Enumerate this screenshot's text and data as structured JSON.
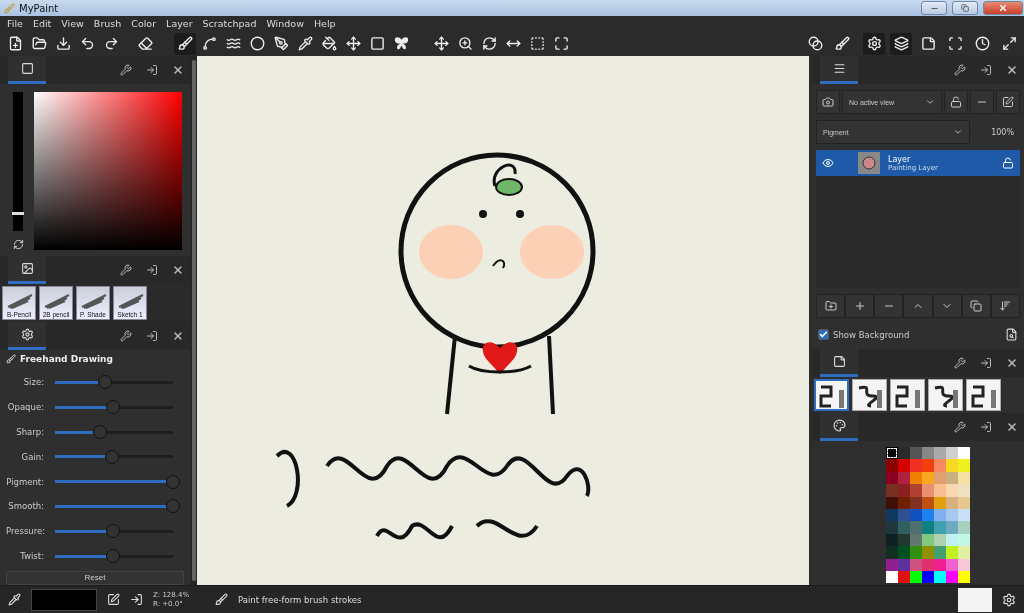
{
  "window": {
    "title": "MyPaint"
  },
  "menu": [
    "File",
    "Edit",
    "View",
    "Brush",
    "Color",
    "Layer",
    "Scratchpad",
    "Window",
    "Help"
  ],
  "toolbar": {
    "tools": [
      {
        "selected": false
      },
      {
        "selected": false
      },
      {
        "selected": false
      },
      {
        "selected": false
      },
      {
        "selected": false
      },
      {
        "selected": false
      },
      {
        "selected": true
      },
      {
        "selected": false
      },
      {
        "selected": false
      },
      {
        "selected": false
      },
      {
        "selected": false
      },
      {
        "selected": false
      },
      {
        "selected": false
      },
      {
        "selected": false
      },
      {
        "selected": false
      },
      {
        "selected": false
      },
      {
        "selected": false
      },
      {
        "selected": false
      },
      {
        "selected": false
      },
      {
        "selected": false
      },
      {
        "selected": false
      },
      {
        "selected": false
      }
    ],
    "panels": [
      {
        "selected": false
      },
      {
        "selected": false
      },
      {
        "selected": true
      },
      {
        "selected": true
      },
      {
        "selected": false
      },
      {
        "selected": false
      },
      {
        "selected": false
      },
      {
        "selected": false
      }
    ]
  },
  "brush_list": {
    "brushes": [
      {
        "label": "B-Pencil",
        "selected": false
      },
      {
        "label": "2B pencil",
        "selected": false
      },
      {
        "label": "P. Shade",
        "selected": false
      },
      {
        "label": "Sketch 1",
        "selected": false
      }
    ]
  },
  "brush_settings": {
    "title": "Freehand Drawing",
    "sliders": [
      {
        "label": "Size:",
        "level": 0.42
      },
      {
        "label": "Opaque:",
        "level": 0.49
      },
      {
        "label": "Sharp:",
        "level": 0.38
      },
      {
        "label": "Gain:",
        "level": 0.48
      },
      {
        "label": "Pigment:",
        "level": 1
      },
      {
        "label": "Smooth:",
        "level": 1
      },
      {
        "label": "Pressure:",
        "level": 0.49
      },
      {
        "label": "Twist:",
        "level": 0.49
      }
    ],
    "reset": "Reset"
  },
  "layers": {
    "view": "No active view",
    "mode": "Pigment",
    "opacity": "100%",
    "items": [
      {
        "name": "Layer",
        "type": "Painting Layer",
        "selected": true,
        "visible": true,
        "locked": false
      }
    ],
    "show_background": {
      "label": "Show Background",
      "checked": true
    }
  },
  "quick_brushes": [
    {
      "selected": true
    },
    {
      "selected": false
    },
    {
      "selected": false
    },
    {
      "selected": false
    },
    {
      "selected": false
    }
  ],
  "palette": [
    {
      "color": "#0a0a0a",
      "selected": true
    },
    {
      "color": "#2a2a2a",
      "selected": false
    },
    {
      "color": "#555555",
      "selected": false
    },
    {
      "color": "#888888",
      "selected": false
    },
    {
      "color": "#aaaaaa",
      "selected": false
    },
    {
      "color": "#d0d0d0",
      "selected": false
    },
    {
      "color": "#ffffff",
      "selected": false
    },
    {
      "color": "#8b0000",
      "selected": false
    },
    {
      "color": "#d40000",
      "selected": false
    },
    {
      "color": "#f03020",
      "selected": false
    },
    {
      "color": "#f04010",
      "selected": false
    },
    {
      "color": "#f88860",
      "selected": false
    },
    {
      "color": "#f8d820",
      "selected": false
    },
    {
      "color": "#f0f020",
      "selected": false
    },
    {
      "color": "#8a0020",
      "selected": false
    },
    {
      "color": "#b02040",
      "selected": false
    },
    {
      "color": "#f08000",
      "selected": false
    },
    {
      "color": "#f8a820",
      "selected": false
    },
    {
      "color": "#e0a070",
      "selected": false
    },
    {
      "color": "#c8b080",
      "selected": false
    },
    {
      "color": "#f8e0a0",
      "selected": false
    },
    {
      "color": "#7a3020",
      "selected": false
    },
    {
      "color": "#8a2020",
      "selected": false
    },
    {
      "color": "#b04030",
      "selected": false
    },
    {
      "color": "#e89070",
      "selected": false
    },
    {
      "color": "#f8c090",
      "selected": false
    },
    {
      "color": "#f8d8b0",
      "selected": false
    },
    {
      "color": "#f0e0c0",
      "selected": false
    },
    {
      "color": "#401008",
      "selected": false
    },
    {
      "color": "#702000",
      "selected": false
    },
    {
      "color": "#803020",
      "selected": false
    },
    {
      "color": "#c05010",
      "selected": false
    },
    {
      "color": "#e0a010",
      "selected": false
    },
    {
      "color": "#d8b080",
      "selected": false
    },
    {
      "color": "#e8c890",
      "selected": false
    },
    {
      "color": "#103860",
      "selected": false
    },
    {
      "color": "#305090",
      "selected": false
    },
    {
      "color": "#1050c0",
      "selected": false
    },
    {
      "color": "#2080f0",
      "selected": false
    },
    {
      "color": "#80b0f0",
      "selected": false
    },
    {
      "color": "#a8c8f0",
      "selected": false
    },
    {
      "color": "#c8e0f8",
      "selected": false
    },
    {
      "color": "#203840",
      "selected": false
    },
    {
      "color": "#306060",
      "selected": false
    },
    {
      "color": "#507070",
      "selected": false
    },
    {
      "color": "#108080",
      "selected": false
    },
    {
      "color": "#40a0b0",
      "selected": false
    },
    {
      "color": "#70a8c0",
      "selected": false
    },
    {
      "color": "#a8d0c0",
      "selected": false
    },
    {
      "color": "#102020",
      "selected": false
    },
    {
      "color": "#203830",
      "selected": false
    },
    {
      "color": "#607870",
      "selected": false
    },
    {
      "color": "#80c880",
      "selected": false
    },
    {
      "color": "#b0d0b0",
      "selected": false
    },
    {
      "color": "#c0f0f0",
      "selected": false
    },
    {
      "color": "#c0f8e8",
      "selected": false
    },
    {
      "color": "#103020",
      "selected": false
    },
    {
      "color": "#005020",
      "selected": false
    },
    {
      "color": "#309010",
      "selected": false
    },
    {
      "color": "#909000",
      "selected": false
    },
    {
      "color": "#40a070",
      "selected": false
    },
    {
      "color": "#c0f020",
      "selected": false
    },
    {
      "color": "#e0f0a0",
      "selected": false
    },
    {
      "color": "#902090",
      "selected": false
    },
    {
      "color": "#6030a0",
      "selected": false
    },
    {
      "color": "#d05080",
      "selected": false
    },
    {
      "color": "#e03070",
      "selected": false
    },
    {
      "color": "#f02090",
      "selected": false
    },
    {
      "color": "#f060d0",
      "selected": false
    },
    {
      "color": "#f8c8d8",
      "selected": false
    },
    {
      "color": "#ffffff",
      "selected": false
    },
    {
      "color": "#e01010",
      "selected": false
    },
    {
      "color": "#00ff00",
      "selected": false
    },
    {
      "color": "#0000ff",
      "selected": false
    },
    {
      "color": "#00ffff",
      "selected": false
    },
    {
      "color": "#ff00ff",
      "selected": false
    },
    {
      "color": "#ffff00",
      "selected": false
    }
  ],
  "value_slider": {
    "level": 0.12
  },
  "status_bar": {
    "zoom": "Z: 128.4%",
    "rotation": "R: +0.0°",
    "message": "Paint free-form brush strokes"
  }
}
